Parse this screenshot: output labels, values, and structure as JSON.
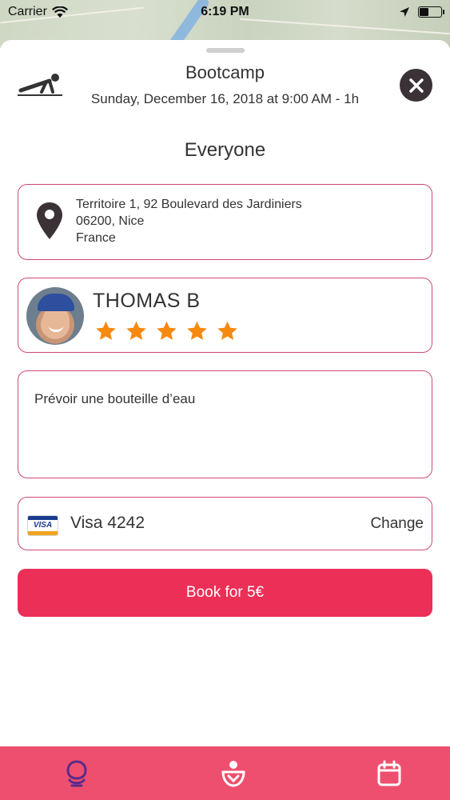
{
  "status_bar": {
    "carrier": "Carrier",
    "time": "6:19 PM"
  },
  "event": {
    "title": "Bootcamp",
    "datetime": "Sunday, December 16, 2018 at 9:00 AM - 1h",
    "audience": "Everyone"
  },
  "address": {
    "line1": "Territoire 1, 92 Boulevard des Jardiniers",
    "line2": "06200, Nice",
    "line3": "France"
  },
  "coach": {
    "name": "THOMAS B",
    "rating": 5,
    "rating_max": 5
  },
  "note": "Prévoir une bouteille d’eau",
  "payment": {
    "card_label": "Visa 4242",
    "change_label": "Change"
  },
  "book_button": "Book for 5€",
  "colors": {
    "accent": "#ec2f56",
    "card_border": "#d04a73",
    "star": "#f6890f",
    "tab_bar": "#ef4f6e"
  },
  "icons": {
    "header": "pushup-icon",
    "close": "close-icon",
    "address": "location-pin-icon",
    "payment": "visa-card-icon",
    "tabs": [
      "profile-icon",
      "coach-icon",
      "calendar-icon"
    ]
  }
}
